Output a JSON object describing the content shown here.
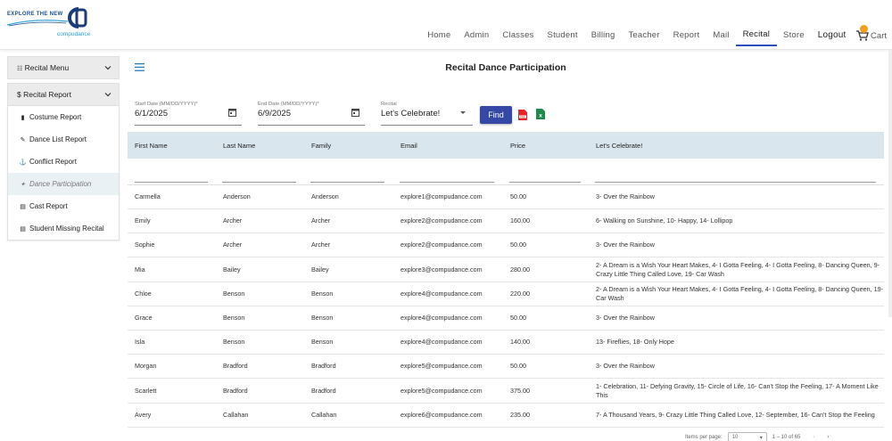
{
  "brand": {
    "tagline": "EXPLORE THE NEW",
    "sub": "compudance",
    "colors": {
      "accent": "#2d4fbf",
      "find": "#3548a6",
      "header_row": "#d9e6ed"
    }
  },
  "nav": {
    "items": [
      "Home",
      "Admin",
      "Classes",
      "Student",
      "Billing",
      "Teacher",
      "Report",
      "Mail",
      "Recital",
      "Store"
    ],
    "logout": "Logout",
    "cart": "Cart"
  },
  "sidebar": {
    "menu_title": "Recital Menu",
    "report_title": "$ Recital Report",
    "items": [
      {
        "label": "Costume Report",
        "icon": "bar-chart-icon"
      },
      {
        "label": "Dance List Report",
        "icon": "wrench-icon"
      },
      {
        "label": "Conflict Report",
        "icon": "conflict-icon"
      },
      {
        "label": "Dance Participation",
        "icon": "dancer-icon"
      },
      {
        "label": "Cast Report",
        "icon": "document-icon"
      },
      {
        "label": "Student Missing Recital",
        "icon": "document-icon"
      }
    ]
  },
  "page": {
    "title": "Recital Dance Participation"
  },
  "filters": {
    "start_label": "Start Date (MM/DD/YYYY)*",
    "start_value": "6/1/2025",
    "end_label": "End Date (MM/DD/YYYY)*",
    "end_value": "6/9/2025",
    "recital_label": "Recital",
    "recital_value": "Let's Celebrate!",
    "find_label": "Find"
  },
  "table": {
    "columns": [
      "First Name",
      "Last Name",
      "Family",
      "Email",
      "Price",
      "Let's Celebrate!"
    ],
    "rows": [
      [
        "Carmella",
        "Anderson",
        "Anderson",
        "explore1@compudance.com",
        "50.00",
        "3- Over the Rainbow"
      ],
      [
        "Emily",
        "Archer",
        "Archer",
        "explore2@compudance.com",
        "160.00",
        "6- Walking on Sunshine, 10- Happy, 14- Lollipop"
      ],
      [
        "Sophie",
        "Archer",
        "Archer",
        "explore2@compudance.com",
        "50.00",
        "3- Over the Rainbow"
      ],
      [
        "Mia",
        "Bailey",
        "Bailey",
        "explore3@compudance.com",
        "280.00",
        "2- A Dream is a Wish Your Heart Makes, 4- I Gotta Feeling, 4- I Gotta Feeling, 8- Dancing Queen, 9- Crazy Little Thing Called Love, 19- Car Wash"
      ],
      [
        "Chloe",
        "Benson",
        "Benson",
        "explore4@compudance.com",
        "220.00",
        "2- A Dream is a Wish Your Heart Makes, 4- I Gotta Feeling, 4- I Gotta Feeling, 8- Dancing Queen, 19- Car Wash"
      ],
      [
        "Grace",
        "Benson",
        "Benson",
        "explore4@compudance.com",
        "50.00",
        "3- Over the Rainbow"
      ],
      [
        "Isla",
        "Benson",
        "Benson",
        "explore4@compudance.com",
        "140.00",
        "13- Fireflies, 18- Only Hope"
      ],
      [
        "Morgan",
        "Bradford",
        "Bradford",
        "explore5@compudance.com",
        "50.00",
        "3- Over the Rainbow"
      ],
      [
        "Scarlett",
        "Bradford",
        "Bradford",
        "explore5@compudance.com",
        "375.00",
        "1- Celebration, 11- Defying Gravity, 15- Circle of Life, 16- Can't Stop the Feeling, 17- A Moment Like This"
      ],
      [
        "Avery",
        "Callahan",
        "Callahan",
        "explore6@compudance.com",
        "235.00",
        "7- A Thousand Years, 9- Crazy Little Thing Called Love, 12- September, 16- Can't Stop the Feeling"
      ]
    ]
  },
  "pager": {
    "items_label": "Items per page:",
    "size": "10",
    "range": "1 – 10 of 65"
  }
}
